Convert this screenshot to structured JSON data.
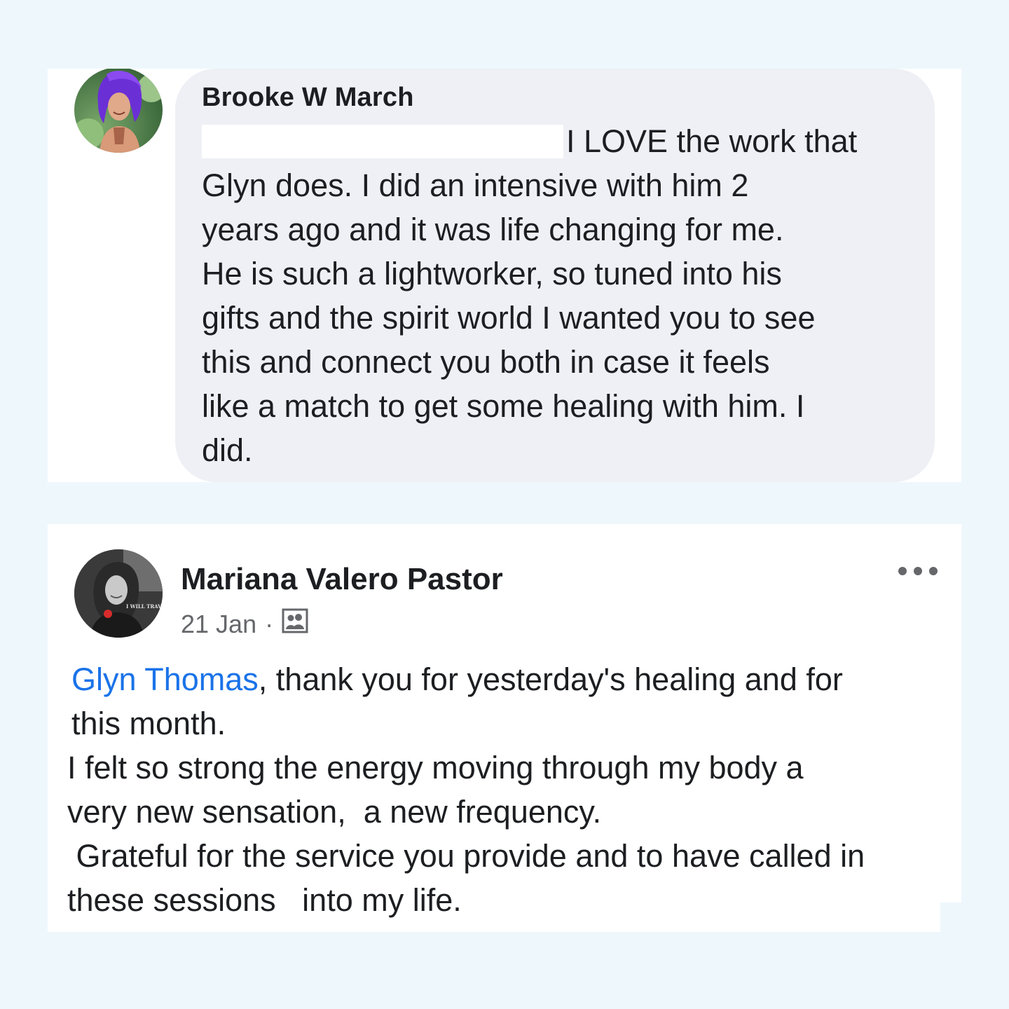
{
  "comment": {
    "author": "Brooke W March",
    "lines": [
      "I LOVE the work that",
      "Glyn does. I did an intensive with him 2",
      "years ago and it was life changing for me.",
      "He is such a lightworker, so tuned into his",
      "gifts and the spirit world I wanted you to see",
      "this and connect you both in case it feels",
      "like a match to get some healing with him. I",
      "did."
    ],
    "redacted_color": "#ffffff",
    "bubble_color": "#eef0f5"
  },
  "post": {
    "author": "Mariana Valero Pastor",
    "date": "21 Jan",
    "separator": "·",
    "audience_icon": "group-audience-icon",
    "more_icon": "more-options-icon",
    "mention": "Glyn Thomas",
    "line1_rest": ", thank you for yesterday's healing and for",
    "lines": [
      "this month.",
      "I felt so strong the energy moving through my body a",
      "very new sensation,  a new frequency.",
      " Grateful for the service you provide and to have called in",
      "these sessions   into my life."
    ],
    "avatar_badge": "I WILL TRAVEL AGAIN",
    "mention_color": "#1a73e8",
    "meta_color": "#65676b"
  },
  "page": {
    "background_color": "#eef8fc"
  }
}
